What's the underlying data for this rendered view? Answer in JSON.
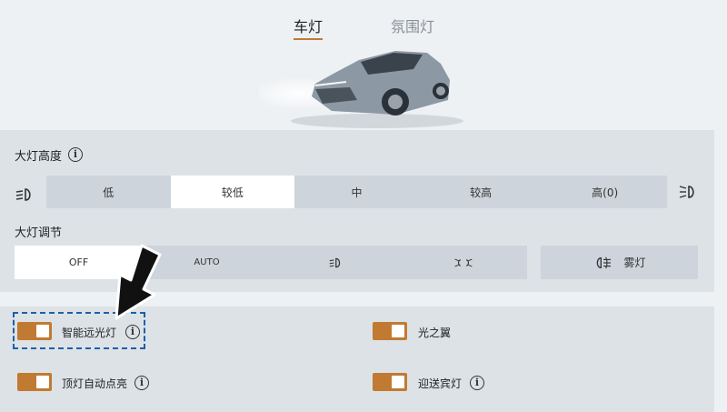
{
  "tabs": [
    {
      "label": "车灯",
      "active": true
    },
    {
      "label": "氛围灯",
      "active": false
    }
  ],
  "headlight_height": {
    "title": "大灯高度",
    "options": [
      "低",
      "较低",
      "中",
      "较高",
      "高(0)"
    ],
    "selected": "较低"
  },
  "headlight_adjust": {
    "title": "大灯调节",
    "options": [
      "OFF",
      "AUTO",
      "low-beam-icon",
      "parking-light-icon"
    ],
    "selected": "OFF",
    "fog_label": "雾灯"
  },
  "toggles": [
    {
      "label": "智能远光灯",
      "on": true,
      "info": true
    },
    {
      "label": "光之翼",
      "on": true,
      "info": false
    },
    {
      "label": "顶灯自动点亮",
      "on": true,
      "info": true
    },
    {
      "label": "迎送宾灯",
      "on": true,
      "info": true
    }
  ],
  "info_glyph": "i",
  "colors": {
    "accent": "#c17a32",
    "selected_bg": "#ffffff",
    "panel_bg": "#dde2e7",
    "highlight": "#1e5fa8"
  }
}
